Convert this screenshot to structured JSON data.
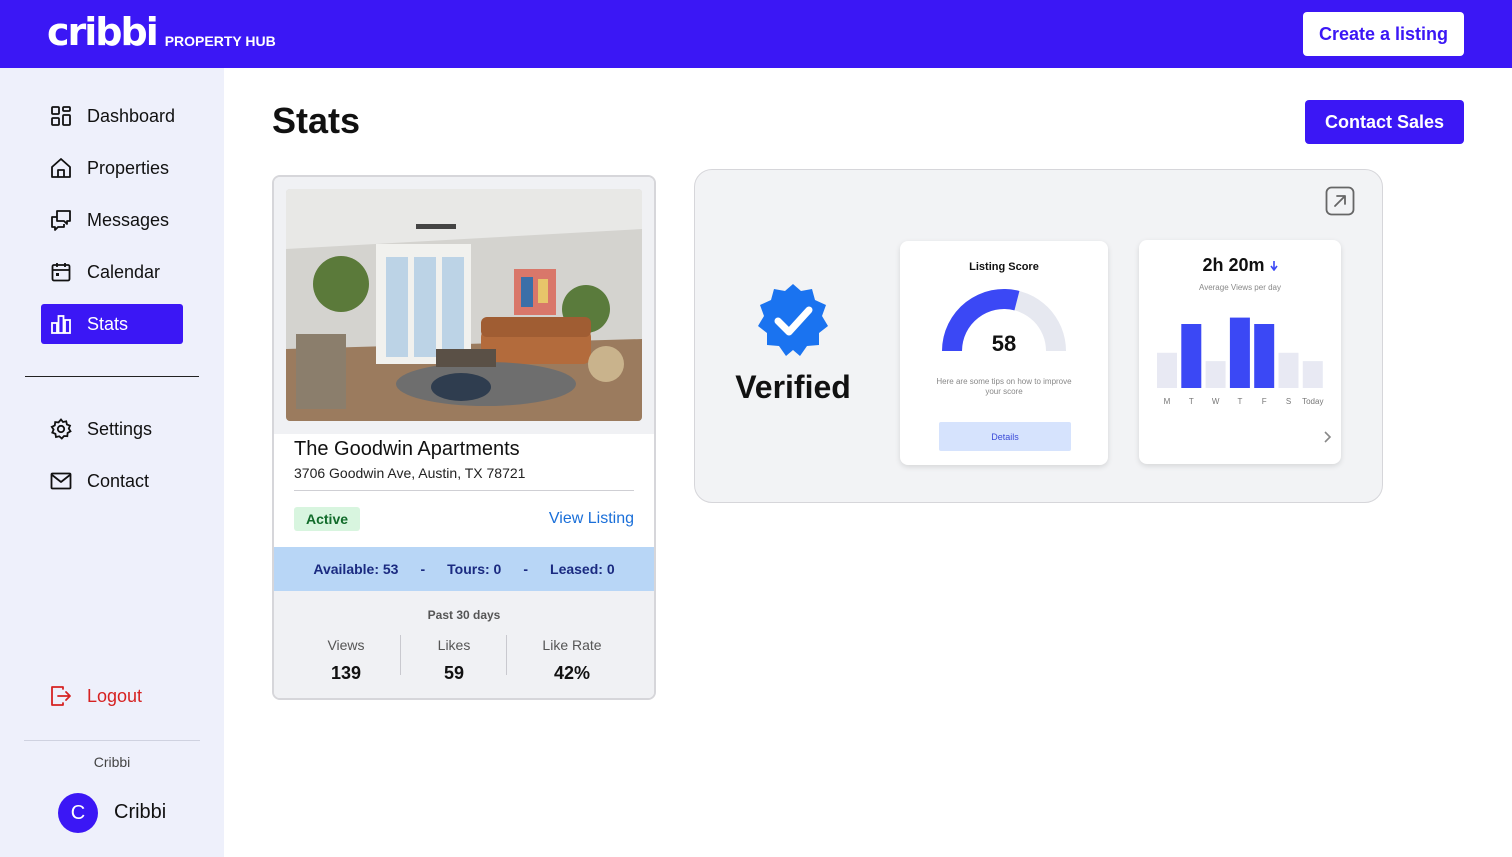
{
  "header": {
    "logo_text": "cribbi",
    "logo_sub": "PROPERTY HUB",
    "create_label": "Create a listing"
  },
  "sidebar": {
    "items": [
      {
        "label": "Dashboard",
        "icon": "dashboard-icon"
      },
      {
        "label": "Properties",
        "icon": "home-icon"
      },
      {
        "label": "Messages",
        "icon": "messages-icon"
      },
      {
        "label": "Calendar",
        "icon": "calendar-icon"
      },
      {
        "label": "Stats",
        "icon": "stats-icon",
        "active": true
      }
    ],
    "settings_label": "Settings",
    "contact_label": "Contact",
    "logout_label": "Logout",
    "org_name": "Cribbi",
    "avatar_initial": "C",
    "user_name": "Cribbi"
  },
  "main": {
    "title": "Stats",
    "contact_sales_label": "Contact Sales"
  },
  "property": {
    "name": "The Goodwin Apartments",
    "address": "3706 Goodwin Ave, Austin, TX 78721",
    "status": "Active",
    "view_link": "View Listing",
    "available": "Available: 53",
    "tours": "Tours: 0",
    "leased": "Leased: 0",
    "sep": "-",
    "period": "Past 30 days",
    "metrics": {
      "views_label": "Views",
      "views_value": "139",
      "likes_label": "Likes",
      "likes_value": "59",
      "rate_label": "Like Rate",
      "rate_value": "42%"
    }
  },
  "promo": {
    "verified_text": "Verified",
    "score_title": "Listing Score",
    "score_value": "58",
    "score_fraction": 0.58,
    "score_tip": "Here are some tips on how to improve your score",
    "details_label": "Details",
    "views_time": "2h 20m",
    "views_sub": "Average Views per day",
    "days": [
      "M",
      "T",
      "W",
      "T",
      "F",
      "S",
      "Today"
    ],
    "day_values": [
      0.55,
      1.0,
      0.42,
      1.1,
      1.0,
      0.55,
      0.42
    ],
    "day_highlight": [
      false,
      true,
      false,
      true,
      true,
      false,
      false
    ]
  },
  "colors": {
    "brand": "#3b17f5",
    "status_active_bg": "#d8f5df",
    "logout": "#d62222",
    "verified_blue": "#1a73f0"
  }
}
